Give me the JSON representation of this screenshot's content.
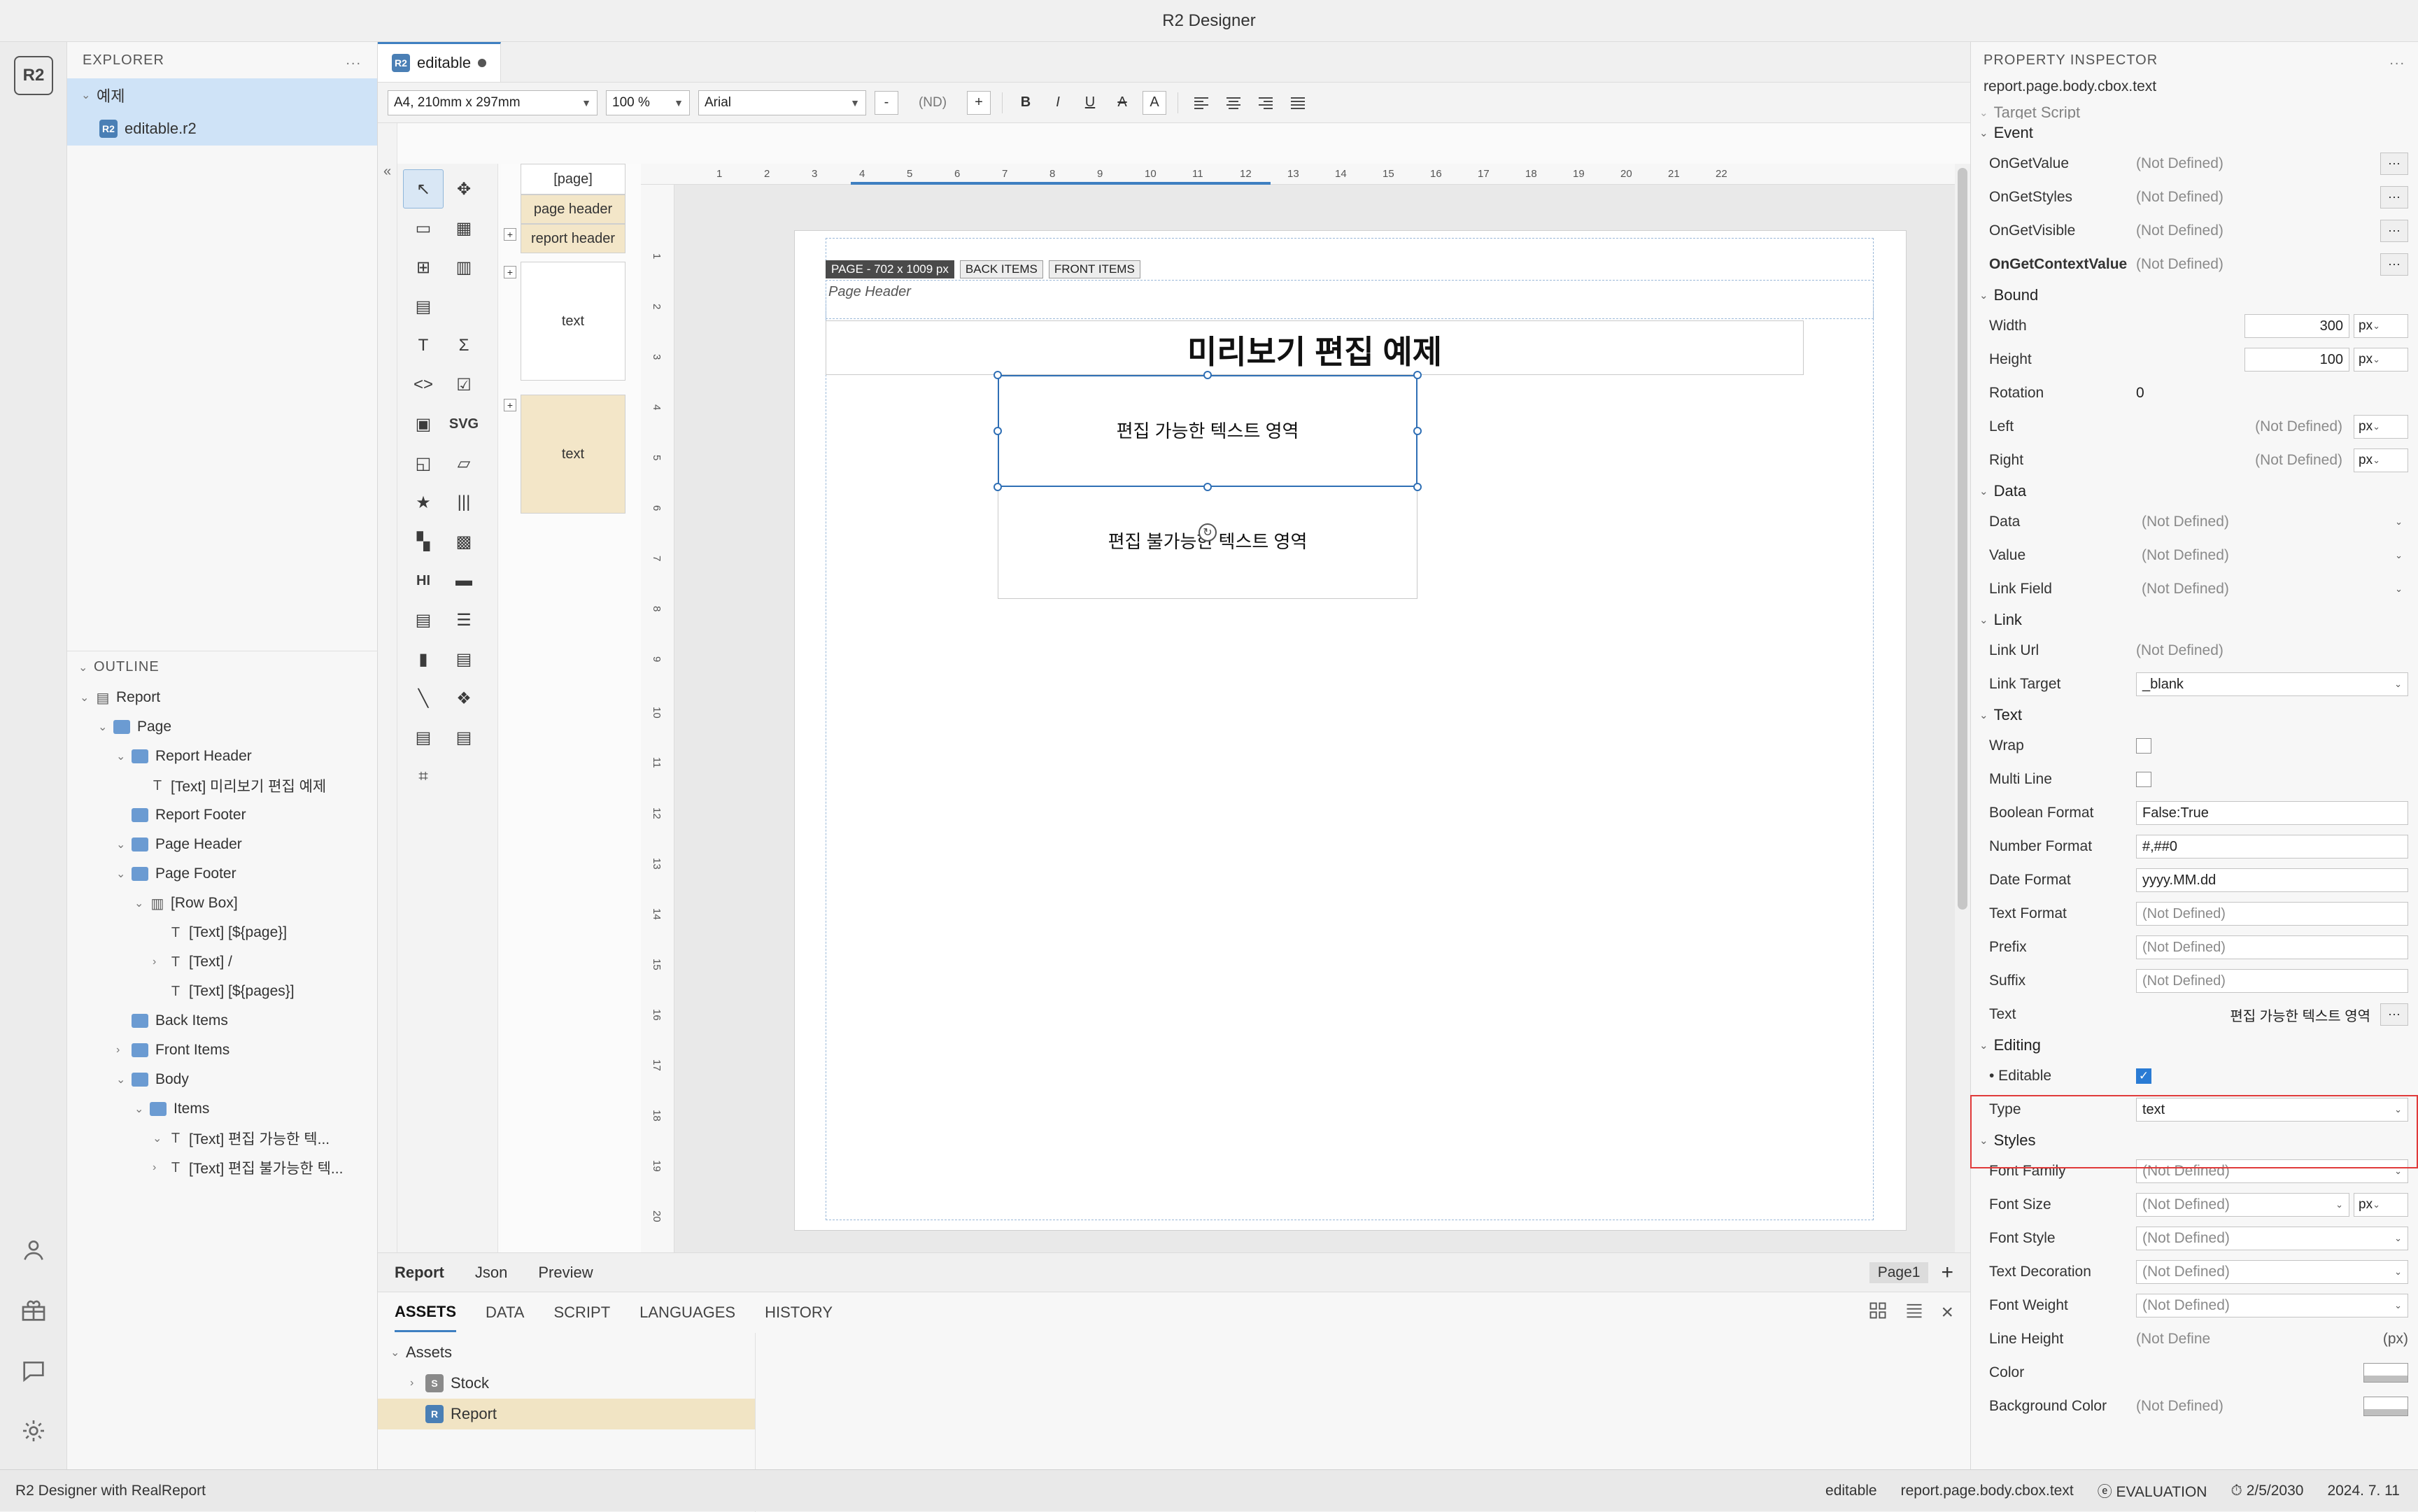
{
  "window": {
    "title": "R2 Designer"
  },
  "rail": {
    "logo": "R2",
    "icons": [
      "r2-logo-icon",
      "account-icon",
      "gift-icon",
      "chat-icon",
      "gear-icon"
    ]
  },
  "explorer": {
    "header": "EXPLORER",
    "dots": "...",
    "root": "예제",
    "file": "editable.r2",
    "outline_header": "OUTLINE",
    "outline": [
      {
        "label": "Report",
        "depth": 0,
        "chev": "⌄",
        "icon": "report-icon"
      },
      {
        "label": "Page",
        "depth": 1,
        "chev": "⌄",
        "icon": "folder-icon"
      },
      {
        "label": "Report Header",
        "depth": 2,
        "chev": "⌄",
        "icon": "folder-icon"
      },
      {
        "label": "[Text] 미리보기 편집 예제",
        "depth": 3,
        "chev": "",
        "icon": "text-icon"
      },
      {
        "label": "Report Footer",
        "depth": 2,
        "chev": "",
        "icon": "folder-icon"
      },
      {
        "label": "Page Header",
        "depth": 2,
        "chev": "⌄",
        "icon": "folder-icon"
      },
      {
        "label": "Page Footer",
        "depth": 2,
        "chev": "⌄",
        "icon": "folder-icon"
      },
      {
        "label": "[Row Box]",
        "depth": 3,
        "chev": "⌄",
        "icon": "rowbox-icon"
      },
      {
        "label": "[Text] [${page}]",
        "depth": 4,
        "chev": "",
        "icon": "text-icon"
      },
      {
        "label": "[Text] /",
        "depth": 4,
        "chev": "›",
        "icon": "text-icon"
      },
      {
        "label": "[Text] [${pages}]",
        "depth": 4,
        "chev": "",
        "icon": "text-icon"
      },
      {
        "label": "Back Items",
        "depth": 2,
        "chev": "",
        "icon": "folder-icon"
      },
      {
        "label": "Front Items",
        "depth": 2,
        "chev": "›",
        "icon": "folder-icon"
      },
      {
        "label": "Body",
        "depth": 2,
        "chev": "⌄",
        "icon": "folder-icon"
      },
      {
        "label": "Items",
        "depth": 3,
        "chev": "⌄",
        "icon": "folder-icon"
      },
      {
        "label": "[Text] 편집 가능한 텍...",
        "depth": 4,
        "chev": "⌄",
        "icon": "text-icon"
      },
      {
        "label": "[Text] 편집 불가능한 텍...",
        "depth": 4,
        "chev": "›",
        "icon": "text-icon"
      }
    ]
  },
  "doctab": {
    "name": "editable",
    "modified_dot": "●"
  },
  "toolbar": {
    "paper_size": "A4, 210mm x 297mm",
    "zoom": "100 %",
    "font": "Arial",
    "minus": "-",
    "font_size": "(ND)",
    "plus": "+",
    "bold": "B",
    "italic": "I",
    "underline": "U",
    "strike": "A",
    "highlight": "A",
    "align_left": "align-left-icon",
    "align_center": "align-center-icon",
    "align_right": "align-right-icon",
    "align_justify": "align-justify-icon"
  },
  "palette": {
    "tools": [
      "cursor-icon",
      "move-icon",
      "rect-icon",
      "table-icon",
      "crosstab-icon",
      "columns-icon",
      "grid-icon",
      "",
      "text-icon",
      "sigma-icon",
      "code-icon",
      "checkbox-icon",
      "image-icon",
      "SVG",
      "shapes-icon",
      "chart-icon",
      "star-icon",
      "barcode-icon",
      "qr-icon",
      "dotmatrix-icon",
      "HI",
      "hr-icon",
      "html-icon",
      "list-icon",
      "bar-chart-icon",
      "bar-h-icon",
      "line-icon",
      "layers-icon",
      "rows-icon",
      "list2-icon",
      "tree-icon",
      ""
    ]
  },
  "strip": {
    "blocks": [
      {
        "label": "[page]",
        "beige": false
      },
      {
        "label": "page header",
        "beige": true
      },
      {
        "label": "report header",
        "beige": true
      },
      {
        "label": "text",
        "beige": false
      },
      {
        "label": "text",
        "beige": true
      }
    ]
  },
  "ruler": {
    "h_ticks": [
      "1",
      "2",
      "3",
      "4",
      "5",
      "6",
      "7",
      "8",
      "9",
      "10",
      "11",
      "12",
      "13",
      "14",
      "15",
      "16",
      "17",
      "18",
      "19",
      "20",
      "21",
      "22"
    ],
    "v_ticks": [
      "1",
      "2",
      "3",
      "4",
      "5",
      "6",
      "7",
      "8",
      "9",
      "10",
      "11",
      "12",
      "13",
      "14",
      "15",
      "16",
      "17",
      "18",
      "19",
      "20"
    ]
  },
  "canvas": {
    "page_badge": "PAGE - 702 x 1009 px",
    "back_items": "BACK ITEMS",
    "front_items": "FRONT ITEMS",
    "page_header_label": "Page Header",
    "report_title": "미리보기 편집 예제",
    "editable_text": "편집 가능한 텍스트 영역",
    "noneditable_text": "편집 불가능한 텍스트 영역",
    "rotate_handle": "rotate-icon"
  },
  "center_tabs": {
    "tabs": [
      "Report",
      "Json",
      "Preview"
    ],
    "page_indicator": "Page1",
    "add": "+"
  },
  "assets": {
    "tabs": [
      "ASSETS",
      "DATA",
      "SCRIPT",
      "LANGUAGES",
      "HISTORY"
    ],
    "selected_tab": "ASSETS",
    "grid_icon": "grid-view-icon",
    "list_icon": "list-view-icon",
    "close_icon": "×",
    "tree": [
      {
        "label": "Assets",
        "depth": 0,
        "chev": "⌄",
        "sel": false
      },
      {
        "label": "Stock",
        "depth": 1,
        "chev": "›",
        "sel": false
      },
      {
        "label": "Report",
        "depth": 1,
        "chev": "",
        "sel": true
      }
    ]
  },
  "inspector": {
    "header": "PROPERTY INSPECTOR",
    "dots": "...",
    "path": "report.page.body.cbox.text",
    "clipped_group": "Target Script",
    "groups": [
      {
        "name": "Event",
        "rows": [
          {
            "label": "OnGetValue",
            "value": "(Not Defined)",
            "kind": "dots"
          },
          {
            "label": "OnGetStyles",
            "value": "(Not Defined)",
            "kind": "dots"
          },
          {
            "label": "OnGetVisible",
            "value": "(Not Defined)",
            "kind": "dots"
          },
          {
            "label": "OnGetContextValue",
            "value": "(Not Defined)",
            "kind": "dots",
            "bold": true
          }
        ]
      },
      {
        "name": "Bound",
        "rows": [
          {
            "label": "Width",
            "value": "300",
            "kind": "num-unit",
            "unit": "px"
          },
          {
            "label": "Height",
            "value": "100",
            "kind": "num-unit",
            "unit": "px"
          },
          {
            "label": "Rotation",
            "value": "0",
            "kind": "plain"
          },
          {
            "label": "Left",
            "value": "(Not Defined)",
            "kind": "nd-unit",
            "unit": "px"
          },
          {
            "label": "Right",
            "value": "(Not Defined)",
            "kind": "nd-unit",
            "unit": "px"
          }
        ]
      },
      {
        "name": "Data",
        "rows": [
          {
            "label": "Data",
            "value": "(Not Defined)",
            "kind": "select"
          },
          {
            "label": "Value",
            "value": "(Not Defined)",
            "kind": "select"
          },
          {
            "label": "Link Field",
            "value": "(Not Defined)",
            "kind": "select"
          }
        ]
      },
      {
        "name": "Link",
        "rows": [
          {
            "label": "Link Url",
            "value": "(Not Defined)",
            "kind": "plain-nd"
          },
          {
            "label": "Link Target",
            "value": "_blank",
            "kind": "select-val"
          }
        ]
      },
      {
        "name": "Text",
        "rows": [
          {
            "label": "Wrap",
            "value": "",
            "kind": "checkbox"
          },
          {
            "label": "Multi Line",
            "value": "",
            "kind": "checkbox"
          },
          {
            "label": "Boolean Format",
            "value": "False:True",
            "kind": "text"
          },
          {
            "label": "Number Format",
            "value": "#,##0",
            "kind": "text"
          },
          {
            "label": "Date Format",
            "value": "yyyy.MM.dd",
            "kind": "text"
          },
          {
            "label": "Text Format",
            "value": "(Not Defined)",
            "kind": "text-nd"
          },
          {
            "label": "Prefix",
            "value": "(Not Defined)",
            "kind": "text-nd"
          },
          {
            "label": "Suffix",
            "value": "(Not Defined)",
            "kind": "text-nd"
          },
          {
            "label": "Text",
            "value": "편집 가능한 텍스트 영역",
            "kind": "text-dots"
          }
        ]
      },
      {
        "name": "Editing",
        "highlighted": true,
        "rows": [
          {
            "label": "Editable",
            "value": "",
            "kind": "checkbox-on",
            "bullet": true
          },
          {
            "label": "Type",
            "value": "text",
            "kind": "select-val"
          }
        ]
      },
      {
        "name": "Styles",
        "rows": [
          {
            "label": "Font Family",
            "value": "(Not Defined)",
            "kind": "select-nd"
          },
          {
            "label": "Font Size",
            "value": "(Not Defined)",
            "kind": "select-nd-unit",
            "unit": "px"
          },
          {
            "label": "Font Style",
            "value": "(Not Defined)",
            "kind": "select-nd"
          },
          {
            "label": "Text Decoration",
            "value": "(Not Defined)",
            "kind": "select-nd"
          },
          {
            "label": "Font Weight",
            "value": "(Not Defined)",
            "kind": "select-nd"
          },
          {
            "label": "Line Height",
            "value": "(Not Define",
            "kind": "lineheight",
            "unit": "(px)"
          },
          {
            "label": "Color",
            "value": "",
            "kind": "swatch"
          },
          {
            "label": "Background Color",
            "value": "(Not Defined)",
            "kind": "swatch-nd"
          }
        ]
      }
    ]
  },
  "status": {
    "left": "R2 Designer with RealReport",
    "file": "editable",
    "path": "report.page.body.cbox.text",
    "evaluation": "EVALUATION",
    "expiry": "2/5/2030",
    "date": "2024. 7. 11"
  },
  "colors": {
    "accent": "#3e7fc1",
    "selection": "#2f6fb5",
    "highlight_red": "#e03a3a",
    "tree_selected": "#cfe3f7",
    "beige": "#f3e6c8"
  }
}
